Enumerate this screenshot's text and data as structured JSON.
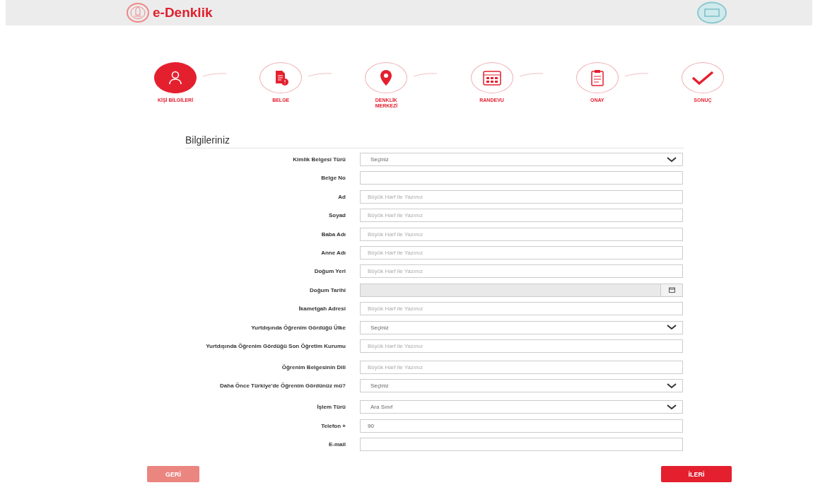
{
  "header": {
    "brand": "e-Denklik"
  },
  "steps": [
    {
      "label": "KİŞİ BİLGİLERİ",
      "selected": true
    },
    {
      "label": "BELGE",
      "selected": false
    },
    {
      "label": "DENKLİK MERKEZİ",
      "selected": false
    },
    {
      "label": "RANDEVU",
      "selected": false
    },
    {
      "label": "ONAY",
      "selected": false
    },
    {
      "label": "SONUÇ",
      "selected": false
    }
  ],
  "form": {
    "title": "Bilgileriniz",
    "fields": [
      {
        "label": "Kimlik Belgesi Türü",
        "kind": "select",
        "value": "Seçiniz"
      },
      {
        "label": "Belge No",
        "kind": "text"
      },
      {
        "label": "Ad",
        "kind": "text",
        "placeholder": "Büyük Harf ile Yazınız"
      },
      {
        "label": "Soyad",
        "kind": "text",
        "placeholder": "Büyük Harf ile Yazınız"
      },
      {
        "label": "Baba Adı",
        "kind": "text",
        "placeholder": "Büyük Harf ile Yazınız"
      },
      {
        "label": "Anne Adı",
        "kind": "text",
        "placeholder": "Büyük Harf ile Yazınız"
      },
      {
        "label": "Doğum Yeri",
        "kind": "text",
        "placeholder": "Büyük Harf ile Yazınız"
      },
      {
        "label": "Doğum Tarihi",
        "kind": "date"
      },
      {
        "label": "İkametgah Adresi",
        "kind": "text",
        "placeholder": "Büyük Harf ile Yazınız"
      },
      {
        "label": "Yurtdışında Öğrenim Gördüğü Ülke",
        "kind": "select",
        "value": "Seçiniz"
      },
      {
        "label": "Yurtdışında Öğrenim Gördüğü Son Öğretim Kurumu",
        "kind": "text",
        "placeholder": "Büyük Harf ile Yazınız"
      },
      {
        "label": "Öğrenim Belgesinin Dili",
        "kind": "text",
        "placeholder": "Büyük Harf ile Yazınız"
      },
      {
        "label": "Daha Önce Türkiye'de Öğrenim Gördünüz mü?",
        "kind": "select",
        "value": "Seçiniz"
      },
      {
        "label": "İşlem Türü",
        "kind": "select",
        "value": "Ara Sınıf"
      },
      {
        "label": "Telefon +",
        "kind": "text",
        "value": "90"
      },
      {
        "label": "E-mail",
        "kind": "text"
      }
    ]
  },
  "buttons": [
    {
      "label": "GERİ",
      "disabled": true
    },
    {
      "label": "İLERİ",
      "disabled": false
    }
  ]
}
